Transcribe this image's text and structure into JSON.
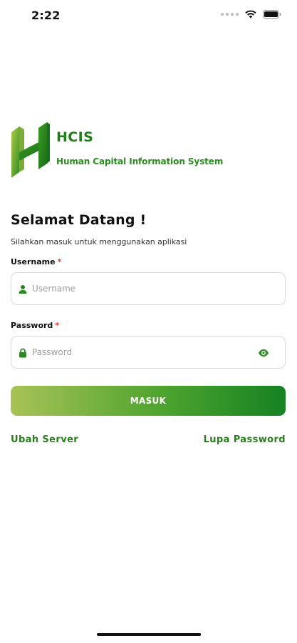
{
  "status_bar": {
    "time": "2:22",
    "icons": [
      "wifi-icon",
      "battery-icon"
    ]
  },
  "brand": {
    "title": "HCIS",
    "subtitle": "Human Capital Information System",
    "logo_icon": "hcis-logo-icon",
    "primary_color": "#1e7f18"
  },
  "login": {
    "heading": "Selamat Datang !",
    "subheading": "Silahkan masuk untuk menggunakan aplikasi",
    "username": {
      "label": "Username",
      "required_mark": "*",
      "placeholder": "Username",
      "value": "",
      "icon": "user-icon"
    },
    "password": {
      "label": "Password",
      "required_mark": "*",
      "placeholder": "Password",
      "value": "",
      "icon": "lock-icon",
      "toggle_icon": "eye-icon"
    },
    "submit_label": "MASUK",
    "button_gradient": [
      "#a9c257",
      "#4ea42f",
      "#158121"
    ]
  },
  "links": {
    "change_server": "Ubah Server",
    "forgot_password": "Lupa Password"
  }
}
